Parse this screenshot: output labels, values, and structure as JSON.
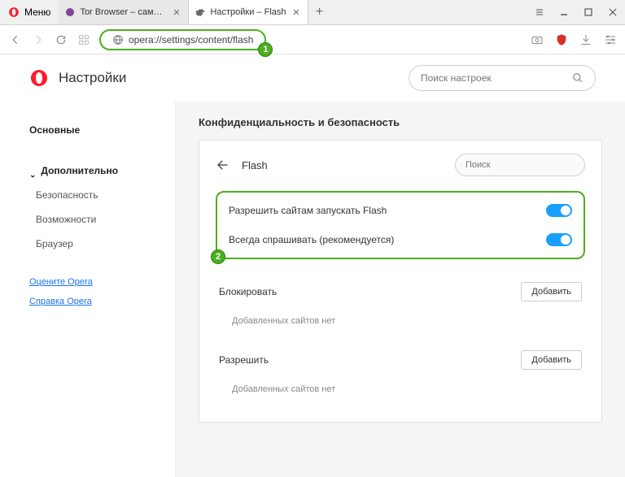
{
  "titlebar": {
    "menu_label": "Меню",
    "tabs": [
      {
        "title": "Tor Browser – самый защи",
        "active": false
      },
      {
        "title": "Настройки – Flash",
        "active": true
      }
    ]
  },
  "addressbar": {
    "url": "opera://settings/content/flash"
  },
  "header": {
    "title": "Настройки",
    "search_placeholder": "Поиск настроек"
  },
  "sidebar": {
    "main": "Основные",
    "advanced": "Дополнительно",
    "security": "Безопасность",
    "features": "Возможности",
    "browser": "Браузер",
    "rate": "Оцените Opera",
    "help": "Справка Opera"
  },
  "content": {
    "section_title": "Конфиденциальность и безопасность",
    "page_title": "Flash",
    "search_placeholder": "Поиск",
    "toggle1": "Разрешить сайтам запускать Flash",
    "toggle2": "Всегда спрашивать (рекомендуется)",
    "block_label": "Блокировать",
    "allow_label": "Разрешить",
    "add_button": "Добавить",
    "empty_message": "Добавленных сайтов нет"
  },
  "annotations": {
    "a1": "1",
    "a2": "2"
  }
}
